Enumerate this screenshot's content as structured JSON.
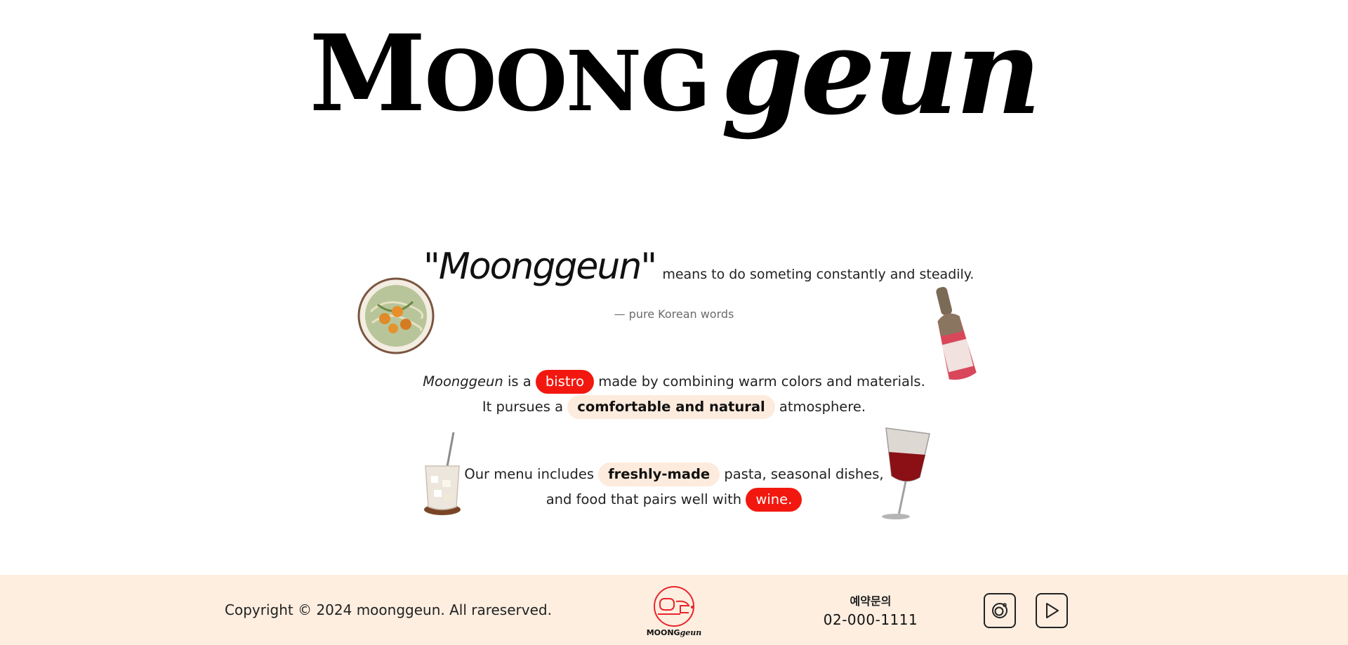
{
  "hero": {
    "brand_caps_initial": "M",
    "brand_caps_rest": "OONG",
    "brand_script": "geun"
  },
  "intro": {
    "quote_word": "\"Moonggeun\"",
    "quote_rest": "means to do someting constantly and steadily.",
    "attribution": "— pure Korean words"
  },
  "paragraph1": {
    "line1_italic": "Moonggeun",
    "line1_pre": "is a",
    "line1_pill": "bistro",
    "line1_post": "made by combining warm colors and materials.",
    "line2_pre": "It pursues a",
    "line2_pill": "comfortable and natural",
    "line2_post": "atmosphere."
  },
  "paragraph2": {
    "line1_pre": "Our menu includes",
    "line1_pill": "freshly-made",
    "line1_post": "pasta, seasonal dishes,",
    "line2_pre": "and food that pairs well with",
    "line2_pill": "wine."
  },
  "footer": {
    "copyright": "Copyright © 2024 moonggeun. All rareserved.",
    "logo_caps": "MOONG",
    "logo_script": "geun",
    "reservation_label": "예약문의",
    "reservation_phone": "02-000-1111",
    "social": [
      "instagram-icon",
      "youtube-play-icon"
    ]
  },
  "colors": {
    "accent_red": "#f2180f",
    "cream": "#fdebdd",
    "footer_bg": "#fdeee0"
  }
}
